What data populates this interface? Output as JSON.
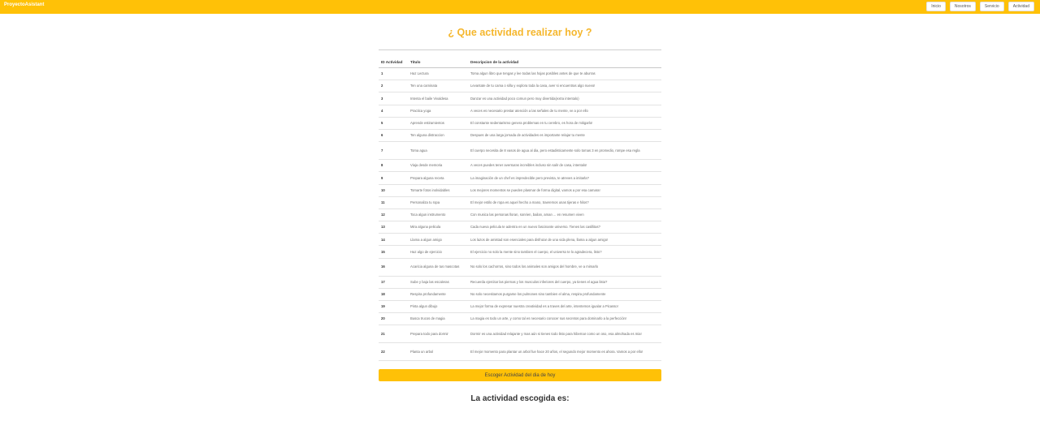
{
  "header": {
    "brand": "ProyectoAsistant",
    "nav": [
      "Inicio",
      "Nosotros",
      "Servicio",
      "Actividad"
    ]
  },
  "title": "¿ Que actividad realizar hoy ?",
  "table": {
    "columns": [
      "ID Actividad",
      "Titulo",
      "Descripcion de la actividad"
    ],
    "rows": [
      {
        "id": "1",
        "title": "Haz Lectura",
        "desc": "Toma algun libro que tengas y lee todas las hojas posibles antes de que te aburras"
      },
      {
        "id": "2",
        "title": "Ten una caminata",
        "desc": "Levantate de tu cama o silla y explora toda la casa, aver si encuentras algo nuevo!"
      },
      {
        "id": "3",
        "title": "Intenta el baile Vivaldesa",
        "desc": "Danzar es una actividad poco comun pero muy divertida(extra intentalo)"
      },
      {
        "id": "4",
        "title": "Practica yoga",
        "desc": "A veces es necesario prestar atención a las señales de tu mente, ve a por ello"
      },
      {
        "id": "5",
        "title": "Aprende estiramientos",
        "desc": "El constante sedentarismo genera problemas en tu cerebro, es hora de mitigarlo!"
      },
      {
        "id": "6",
        "title": "Ten alguna distraccion",
        "desc": "Despues de una larga jornada de actividades es importante relajar tu mente"
      },
      {
        "id": "7",
        "title": "Toma agua",
        "desc": "El cuerpo necesita de 8 vasos de agua al dia, pero estadisticamente solo tomas 3 en promedio, rompe esa regla"
      },
      {
        "id": "8",
        "title": "Viaja desde memoria",
        "desc": "A veces puedes tener aventuras increibles incluso sin salir de casa, intentalo!"
      },
      {
        "id": "9",
        "title": "Prepara alguna receta",
        "desc": "La imaginación de un chef es impredecible pero prevista, te atreves a imitarla?"
      },
      {
        "id": "10",
        "title": "Tomarte fotos inolvidables",
        "desc": "Los mejores momentos se pueden plasmar de forma digital, vamos a por esa camara!"
      },
      {
        "id": "11",
        "title": "Personaliza tu ropa",
        "desc": "El mejor estilo de ropa es aquel hecho a mano, traeremos unas tijeras e hilos?"
      },
      {
        "id": "12",
        "title": "Toca algun instrumento",
        "desc": "Con musica las personas lloran, sonrien, bailan, aman ... en resumen viven"
      },
      {
        "id": "13",
        "title": "Mira alguna pelicula",
        "desc": "Cada nueva pelicula te adentra en un nuevo fascinante universo. Tienes las casillitas?"
      },
      {
        "id": "14",
        "title": "Llama a algun amigo",
        "desc": "Los lazos de amistad son esenciales para disfrutar de una vida plena, llama a algun amigo!"
      },
      {
        "id": "15",
        "title": "Haz algo de ejercicio",
        "desc": "El ejercicio no solo la mente sino tambien el cuerpo, el universo te lo agradecera, listo?"
      },
      {
        "id": "16",
        "title": "Acaricia alguna de tus mascotas",
        "desc": "No solo los cachorros, sino todos los animales son amigos del hombre, ve a mimarlo"
      },
      {
        "id": "17",
        "title": "Sube y baja las escaleras",
        "desc": "Recuerda ejercitar las piernas y los musculos inferiores del cuerpo, ya tienes el agua lista?"
      },
      {
        "id": "18",
        "title": "Respira profundamente",
        "desc": "No solo necesitamos purgarse los pulmones sino tambien el alma, respira profundamente"
      },
      {
        "id": "19",
        "title": "Pinta algun dibujo",
        "desc": "La mejor forma de expresar nuestra creatividad es a traves del arte, intentemos igualar a Picasso!"
      },
      {
        "id": "20",
        "title": "Busca trucos de magia",
        "desc": "La magia es todo un arte, y como tal es necesario conocer sus secretos para dominarlo a la perfección!"
      },
      {
        "id": "21",
        "title": "Prepara todo para dormir",
        "desc": "Dormir es una actividad relajante y mas aún si tienes todo listo para hibernar como un oso, esa almohada es mia!"
      },
      {
        "id": "22",
        "title": "Planta un arbol",
        "desc": "El mejor momento para plantar un arbol fue hace 20 años, el segundo mejor momento es ahora. Vamos a por ello!"
      }
    ]
  },
  "pick_button": "Escoger Actividad del dia de hoy",
  "result_label": "La actividad escogida es:",
  "colors": {
    "accent": "#ffc107",
    "title": "#f5b72e"
  }
}
